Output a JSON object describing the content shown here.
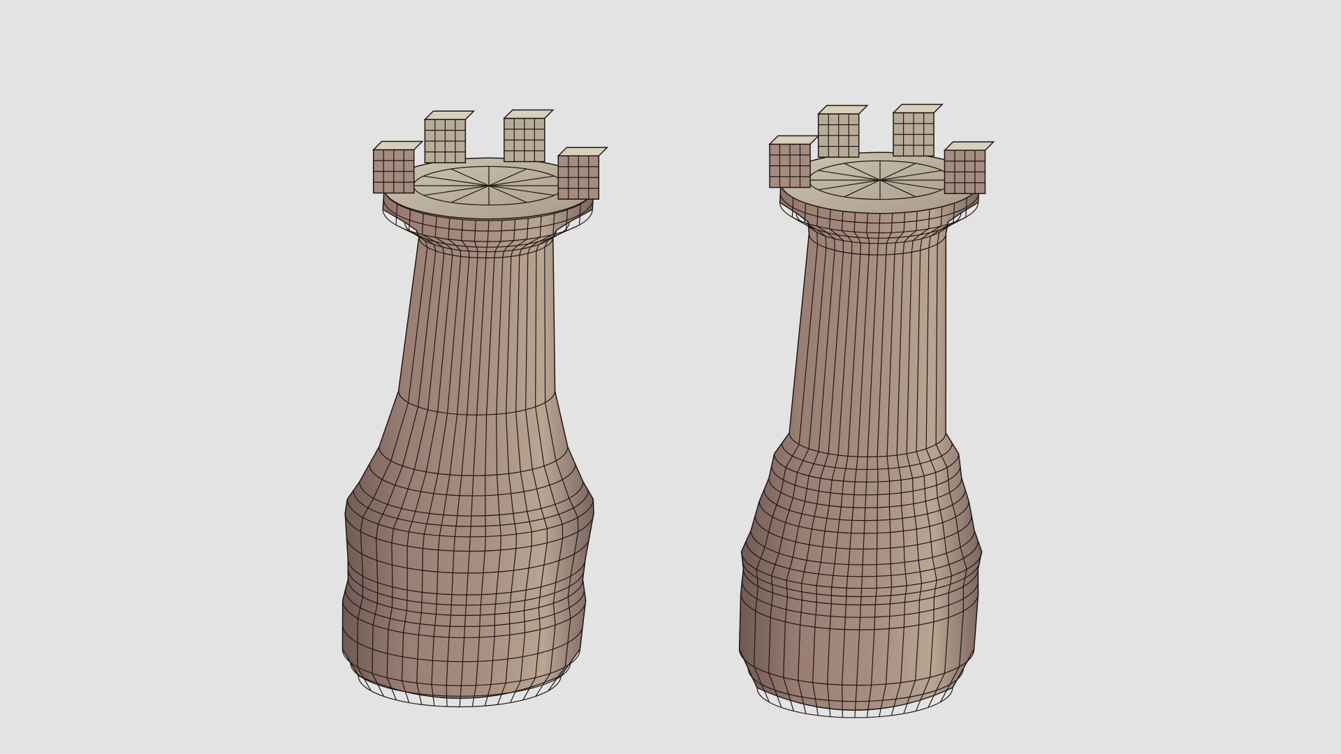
{
  "viewport": {
    "background_color": "#e3e3e3",
    "render_mode": "wireframe-on-shaded"
  },
  "scene": {
    "objects": [
      {
        "name": "rook-mesh-left",
        "kind": "chess-rook",
        "base_color": "#9a7e74",
        "wire_color": "#1e1614",
        "light_color": "#ccc6ae"
      },
      {
        "name": "rook-mesh-right",
        "kind": "chess-rook",
        "base_color": "#9a7e74",
        "wire_color": "#1e1614",
        "light_color": "#ccc6ae"
      }
    ]
  }
}
